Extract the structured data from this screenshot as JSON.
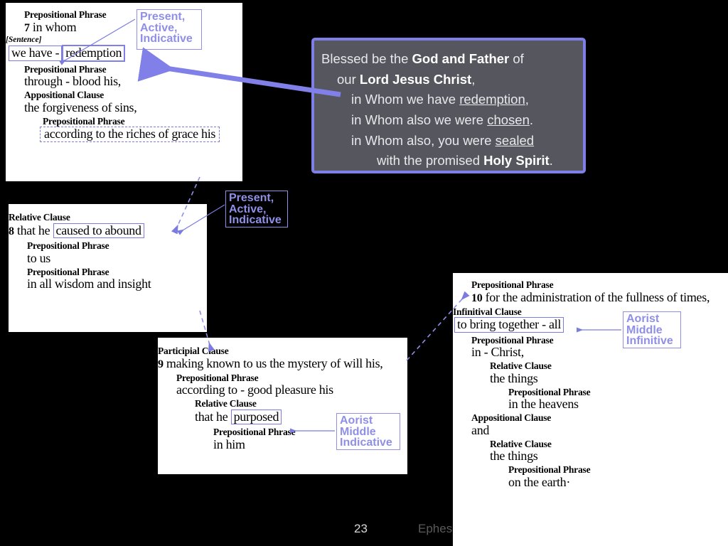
{
  "slide": {
    "page_number": "23",
    "reference_footer": "Ephes",
    "accent_color": "#8080e8",
    "panel_bg": "#56565e"
  },
  "verse_panel": {
    "lines": [
      {
        "indent": 0,
        "parts": [
          {
            "text": "Blessed be the ",
            "style": "plain"
          },
          {
            "text": "God and Father",
            "style": "bold"
          },
          {
            "text": " of",
            "style": "plain"
          }
        ]
      },
      {
        "indent": 1,
        "parts": [
          {
            "text": "our ",
            "style": "plain"
          },
          {
            "text": "Lord Jesus Christ",
            "style": "bold"
          },
          {
            "text": ",",
            "style": "plain"
          }
        ]
      },
      {
        "indent": 2,
        "parts": [
          {
            "text": "in Whom we have ",
            "style": "plain"
          },
          {
            "text": "redemption",
            "style": "underline"
          },
          {
            "text": ",",
            "style": "plain"
          }
        ]
      },
      {
        "indent": 2,
        "parts": [
          {
            "text": "in Whom also we were ",
            "style": "plain"
          },
          {
            "text": "chosen",
            "style": "underline"
          },
          {
            "text": ".",
            "style": "plain"
          }
        ]
      },
      {
        "indent": 2,
        "parts": [
          {
            "text": "in Whom also, you were ",
            "style": "plain"
          },
          {
            "text": "sealed",
            "style": "underline"
          }
        ]
      },
      {
        "indent": 3,
        "parts": [
          {
            "text": "with the promised ",
            "style": "plain"
          },
          {
            "text": "Holy Spirit",
            "style": "bold"
          },
          {
            "text": ".",
            "style": "plain"
          }
        ]
      }
    ]
  },
  "panel_1": {
    "rows": [
      {
        "kind": "hdr",
        "indent": 1,
        "text": "Prepositional Phrase"
      },
      {
        "kind": "txt",
        "indent": 1,
        "verse": "7",
        "text": "in whom"
      },
      {
        "kind": "tag",
        "indent": 0,
        "text": "[Sentence]"
      },
      {
        "kind": "boxpair",
        "indent": 0,
        "left": "we have -",
        "right": "redemption"
      },
      {
        "kind": "hdr",
        "indent": 1,
        "text": "Prepositional Phrase"
      },
      {
        "kind": "txt",
        "indent": 1,
        "text": "through - blood his,"
      },
      {
        "kind": "hdr",
        "indent": 1,
        "text": "Appositional Clause"
      },
      {
        "kind": "txt",
        "indent": 1,
        "text": "the forgiveness of sins,"
      },
      {
        "kind": "hdr",
        "indent": 2,
        "text": "Prepositional Phrase"
      },
      {
        "kind": "dashed",
        "indent": 2,
        "text": "according to the riches of grace his"
      }
    ]
  },
  "panel_2": {
    "rows": [
      {
        "kind": "hdr",
        "indent": 0,
        "text": "Relative Clause"
      },
      {
        "kind": "boxtail",
        "indent": 0,
        "verse": "8",
        "prefix": "that he",
        "boxed": "caused to abound"
      },
      {
        "kind": "hdr",
        "indent": 1,
        "text": "Prepositional Phrase"
      },
      {
        "kind": "txt",
        "indent": 1,
        "text": "to us"
      },
      {
        "kind": "hdr",
        "indent": 1,
        "text": "Prepositional Phrase"
      },
      {
        "kind": "txt",
        "indent": 1,
        "text": "in all wisdom and insight"
      }
    ]
  },
  "panel_3": {
    "rows": [
      {
        "kind": "hdr",
        "indent": 0,
        "text": "Participial Clause"
      },
      {
        "kind": "txt",
        "indent": 0,
        "verse": "9",
        "text": "making known to us the mystery of will his,"
      },
      {
        "kind": "hdr",
        "indent": 1,
        "text": "Prepositional Phrase"
      },
      {
        "kind": "txt",
        "indent": 1,
        "text": "according to - good pleasure his"
      },
      {
        "kind": "hdr",
        "indent": 2,
        "text": "Relative Clause"
      },
      {
        "kind": "boxtail",
        "indent": 2,
        "prefix": "that he",
        "boxed": "purposed"
      },
      {
        "kind": "hdr",
        "indent": 3,
        "text": "Prepositional Phrase"
      },
      {
        "kind": "txt",
        "indent": 3,
        "text": "in him"
      }
    ]
  },
  "panel_4": {
    "rows": [
      {
        "kind": "hdr",
        "indent": 1,
        "text": "Prepositional Phrase"
      },
      {
        "kind": "txt",
        "indent": 1,
        "verse": "10",
        "text": "for the administration of the fullness of times,"
      },
      {
        "kind": "hdr",
        "indent": 0,
        "text": "Infinitival Clause"
      },
      {
        "kind": "boxonly",
        "indent": 0,
        "boxed": "to bring together - all"
      },
      {
        "kind": "hdr",
        "indent": 1,
        "text": "Prepositional Phrase"
      },
      {
        "kind": "txt",
        "indent": 1,
        "text": "in - Christ,"
      },
      {
        "kind": "hdr",
        "indent": 2,
        "text": "Relative Clause"
      },
      {
        "kind": "txt",
        "indent": 2,
        "text": "the things"
      },
      {
        "kind": "hdr",
        "indent": 3,
        "text": "Prepositional Phrase"
      },
      {
        "kind": "txt",
        "indent": 3,
        "text": "in the heavens"
      },
      {
        "kind": "hdr",
        "indent": 1,
        "text": "Appositional Clause"
      },
      {
        "kind": "txt",
        "indent": 1,
        "text": "and"
      },
      {
        "kind": "hdr",
        "indent": 2,
        "text": "Relative Clause"
      },
      {
        "kind": "txt",
        "indent": 2,
        "text": "the things"
      },
      {
        "kind": "hdr",
        "indent": 3,
        "text": "Prepositional Phrase"
      },
      {
        "kind": "txt",
        "indent": 3,
        "text": "on the earth·"
      }
    ]
  },
  "callouts": {
    "c1": "Present,\nActive,\nIndicative",
    "c2": "Present,\nActive,\nIndicative",
    "c3": "Aorist\nMiddle\nIndicative",
    "c4": "Aorist\nMiddle\nInfinitive"
  }
}
